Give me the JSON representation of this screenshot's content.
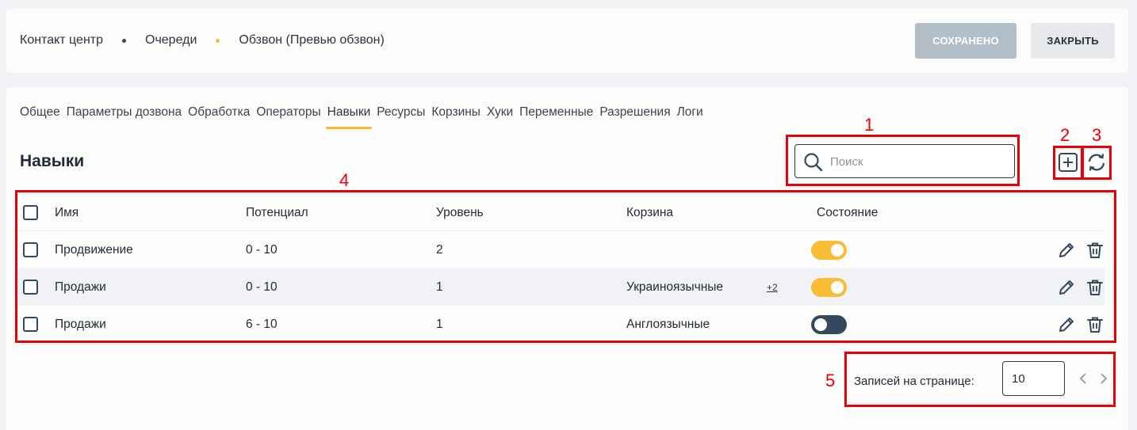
{
  "breadcrumb": {
    "items": [
      "Контакт центр",
      "Очереди",
      "Обзвон (Превью обзвон)"
    ],
    "dot_colors": [
      "#34495e",
      "#f8bd35"
    ]
  },
  "actions": {
    "saved_label": "СОХРАНЕНО",
    "close_label": "ЗАКРЫТЬ"
  },
  "tabs": [
    {
      "label": "Общее",
      "active": false
    },
    {
      "label": "Параметры дозвона",
      "active": false
    },
    {
      "label": "Обработка",
      "active": false
    },
    {
      "label": "Операторы",
      "active": false
    },
    {
      "label": "Навыки",
      "active": true
    },
    {
      "label": "Ресурсы",
      "active": false
    },
    {
      "label": "Корзины",
      "active": false
    },
    {
      "label": "Хуки",
      "active": false
    },
    {
      "label": "Переменные",
      "active": false
    },
    {
      "label": "Разрешения",
      "active": false
    },
    {
      "label": "Логи",
      "active": false
    }
  ],
  "section_title": "Навыки",
  "search": {
    "placeholder": "Поиск",
    "value": ""
  },
  "table": {
    "columns": [
      "Имя",
      "Потенциал",
      "Уровень",
      "Корзина",
      "Состояние"
    ],
    "rows": [
      {
        "name": "Продвижение",
        "potential": "0 - 10",
        "level": "2",
        "basket": "",
        "more": "",
        "enabled": true
      },
      {
        "name": "Продажи",
        "potential": "0 - 10",
        "level": "1",
        "basket": "Украиноязычные",
        "more": "+2",
        "enabled": true
      },
      {
        "name": "Продажи",
        "potential": "6 - 10",
        "level": "1",
        "basket": "Англоязычные",
        "more": "",
        "enabled": false
      }
    ]
  },
  "pagination": {
    "label": "Записей на странице:",
    "page_size": "10"
  },
  "annotations": {
    "search": "1",
    "add": "2",
    "refresh": "3",
    "table": "4",
    "pager": "5"
  },
  "colors": {
    "accent": "#f8bd35",
    "dark": "#34495e",
    "annotation": "#e8000b"
  }
}
